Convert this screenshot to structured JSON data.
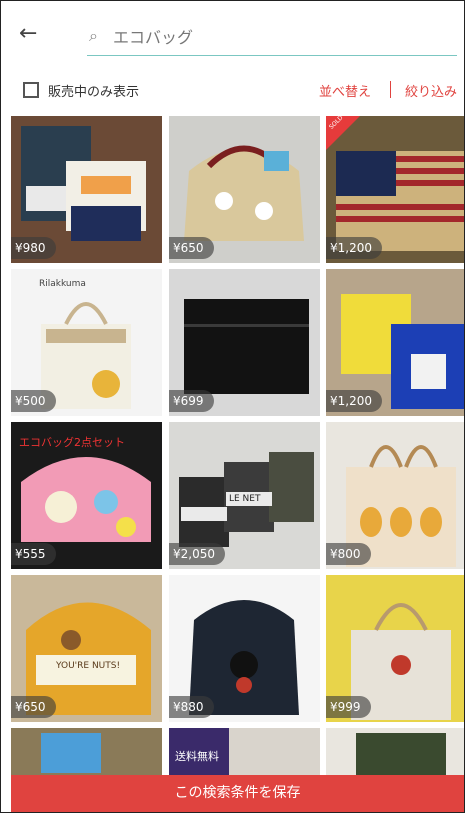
{
  "header": {
    "back_label": "←",
    "search_query": "エコバッグ"
  },
  "filters": {
    "on_sale_only_label": "販売中のみ表示",
    "sort_label": "並べ替え",
    "narrow_label": "絞り込み"
  },
  "items": [
    {
      "price": "¥980"
    },
    {
      "price": "¥650"
    },
    {
      "price": "¥1,200",
      "sold": "SOLD"
    },
    {
      "price": "¥500",
      "overlay": "Rilakkuma"
    },
    {
      "price": "¥699"
    },
    {
      "price": "¥1,200"
    },
    {
      "price": "¥555",
      "overlay": "エコバッグ2点セット"
    },
    {
      "price": "¥2,050",
      "overlay": "LE NET"
    },
    {
      "price": "¥800"
    },
    {
      "price": "¥650",
      "overlay": "YOU'RE NUTS!"
    },
    {
      "price": "¥880"
    },
    {
      "price": "¥999"
    },
    {
      "price": ""
    },
    {
      "price": "",
      "overlay": "送料無料"
    },
    {
      "price": ""
    }
  ],
  "footer": {
    "save_label": "この検索条件を保存"
  },
  "colors": {
    "accent": "#e0433f",
    "search_underline": "#7bc7c2"
  }
}
